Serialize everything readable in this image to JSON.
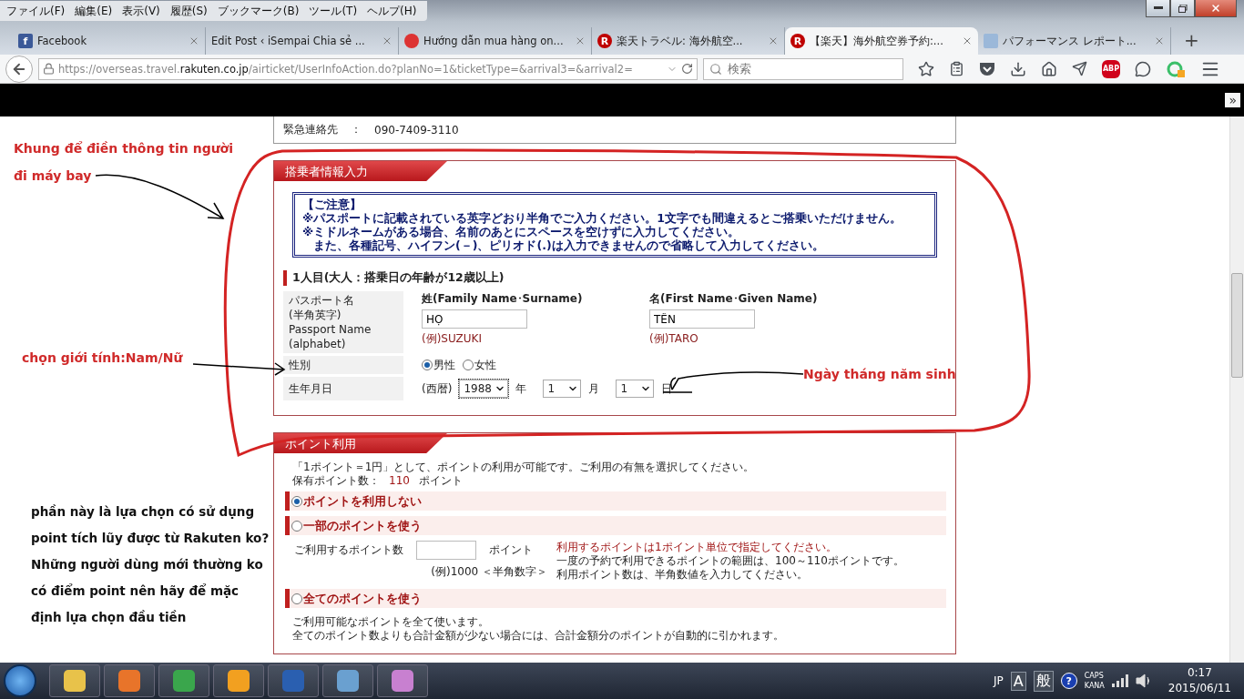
{
  "menu_bar": {
    "items": [
      "ファイル(F)",
      "編集(E)",
      "表示(V)",
      "履歴(S)",
      "ブックマーク(B)",
      "ツール(T)",
      "ヘルプ(H)"
    ]
  },
  "tabs": [
    {
      "label": "Facebook",
      "kind": "facebook",
      "icon_text": "f",
      "selected": false
    },
    {
      "label": "Edit Post ‹ iSempai Chia sẻ ...",
      "kind": "plain",
      "selected": false
    },
    {
      "label": "Hướng dẫn mua hàng on...",
      "kind": "avatar",
      "selected": false
    },
    {
      "label": "楽天トラベル: 海外航空...",
      "kind": "logo",
      "icon_text": "R",
      "selected": false
    },
    {
      "label": "【楽天】海外航空券予約:...",
      "kind": "logo",
      "icon_text": "R",
      "selected": true
    },
    {
      "label": "パフォーマンス レポート...",
      "kind": "page",
      "selected": false
    }
  ],
  "new_tab": "+",
  "address_bar": {
    "url_start": "https://overseas.travel.",
    "url_domain": "rakuten.co.jp",
    "url_path": "/airticket/UserInfoAction.do?planNo=1&ticketType=&arrival3=&arrival2="
  },
  "search_field": {
    "placeholder": "検索"
  },
  "adblock_label": "ABP",
  "bookmarks_overflow": "»",
  "contact": {
    "label": "緊急連絡先",
    "separator": "：",
    "value": "090-7409-3110"
  },
  "passenger_section": {
    "title": "搭乗者情報入力",
    "notice": {
      "heading": "【ご注意】",
      "lines": [
        "※パスポートに記載されている英字どおり半角でご入力ください。1文字でも間違えるとご搭乗いただけません。",
        "※ミドルネームがある場合、名前のあとにスペースを空けずに入力してください。",
        "また、各種記号、ハイフン(－)、ピリオド(.)は入力できませんので省略して入力してください。"
      ]
    },
    "passenger_heading": "1人目(大人：搭乗日の年齢が12歳以上)",
    "name_label_lines": [
      "パスポート名",
      "(半角英字)",
      "Passport Name",
      "(alphabet)"
    ],
    "surname": {
      "label": "姓(Family Name･Surname)",
      "value": "HỌ",
      "example": "(例)SUZUKI"
    },
    "given_name": {
      "label": "名(First Name･Given Name)",
      "value": "TÊN",
      "example": "(例)TARO"
    },
    "gender": {
      "label": "性別",
      "options": [
        {
          "label": "男性",
          "selected": true
        },
        {
          "label": "女性",
          "selected": false
        }
      ]
    },
    "birth": {
      "label": "生年月日",
      "era": "(西暦)",
      "year": "1988",
      "year_unit": "年",
      "month": "1",
      "month_unit": "月",
      "day": "1",
      "day_unit": "日"
    }
  },
  "points_section": {
    "title": "ポイント利用",
    "intro": "「1ポイント＝1円」として、ポイントの利用が可能です。ご利用の有無を選択してください。",
    "balance_label": "保有ポイント数：",
    "balance_value": "110",
    "balance_unit": "ポイント",
    "options": [
      {
        "kind": "plain",
        "label": "ポイントを利用しない",
        "selected": true
      },
      {
        "kind": "partial",
        "label": "一部のポイントを使う",
        "selected": false,
        "field_label": "ご利用するポイント数",
        "unit": "ポイント",
        "example": "(例)1000 ＜半角数字＞",
        "notes": [
          {
            "kind": "warning",
            "text": "利用するポイントは1ポイント単位で指定してください。"
          },
          {
            "kind": "normal",
            "text": "一度の予約で利用できるポイントの範囲は、100～110ポイントです。"
          },
          {
            "kind": "normal",
            "text": "利用ポイント数は、半角数値を入力してください。"
          }
        ]
      },
      {
        "kind": "all",
        "label": "全てのポイントを使う",
        "selected": false,
        "description": [
          "ご利用可能なポイントを全て使います。",
          "全てのポイント数よりも合計金額が少ない場合には、合計金額分のポイントが自動的に引かれます。"
        ]
      }
    ]
  },
  "annotations": [
    {
      "kind": "red",
      "text": "Khung để điền thông tin người đi máy bay"
    },
    {
      "kind": "red",
      "text": "chọn giới tính:Nam/Nữ"
    },
    {
      "kind": "red",
      "text": "Ngày tháng năm sinh"
    },
    {
      "kind": "black",
      "text": "phần này là lựa chọn có sử dụng point tích lũy được từ Rakuten ko? Những người dùng mới thường ko có điểm point nên hãy để mặc định lựa chọn đầu tiền"
    }
  ],
  "taskbar": {
    "language": "JP",
    "ime_mode": "A",
    "ime_kana": "般",
    "caps": "CAPS",
    "kana": "KANA",
    "help": "?",
    "time": "0:17",
    "date": "2015/06/11"
  }
}
